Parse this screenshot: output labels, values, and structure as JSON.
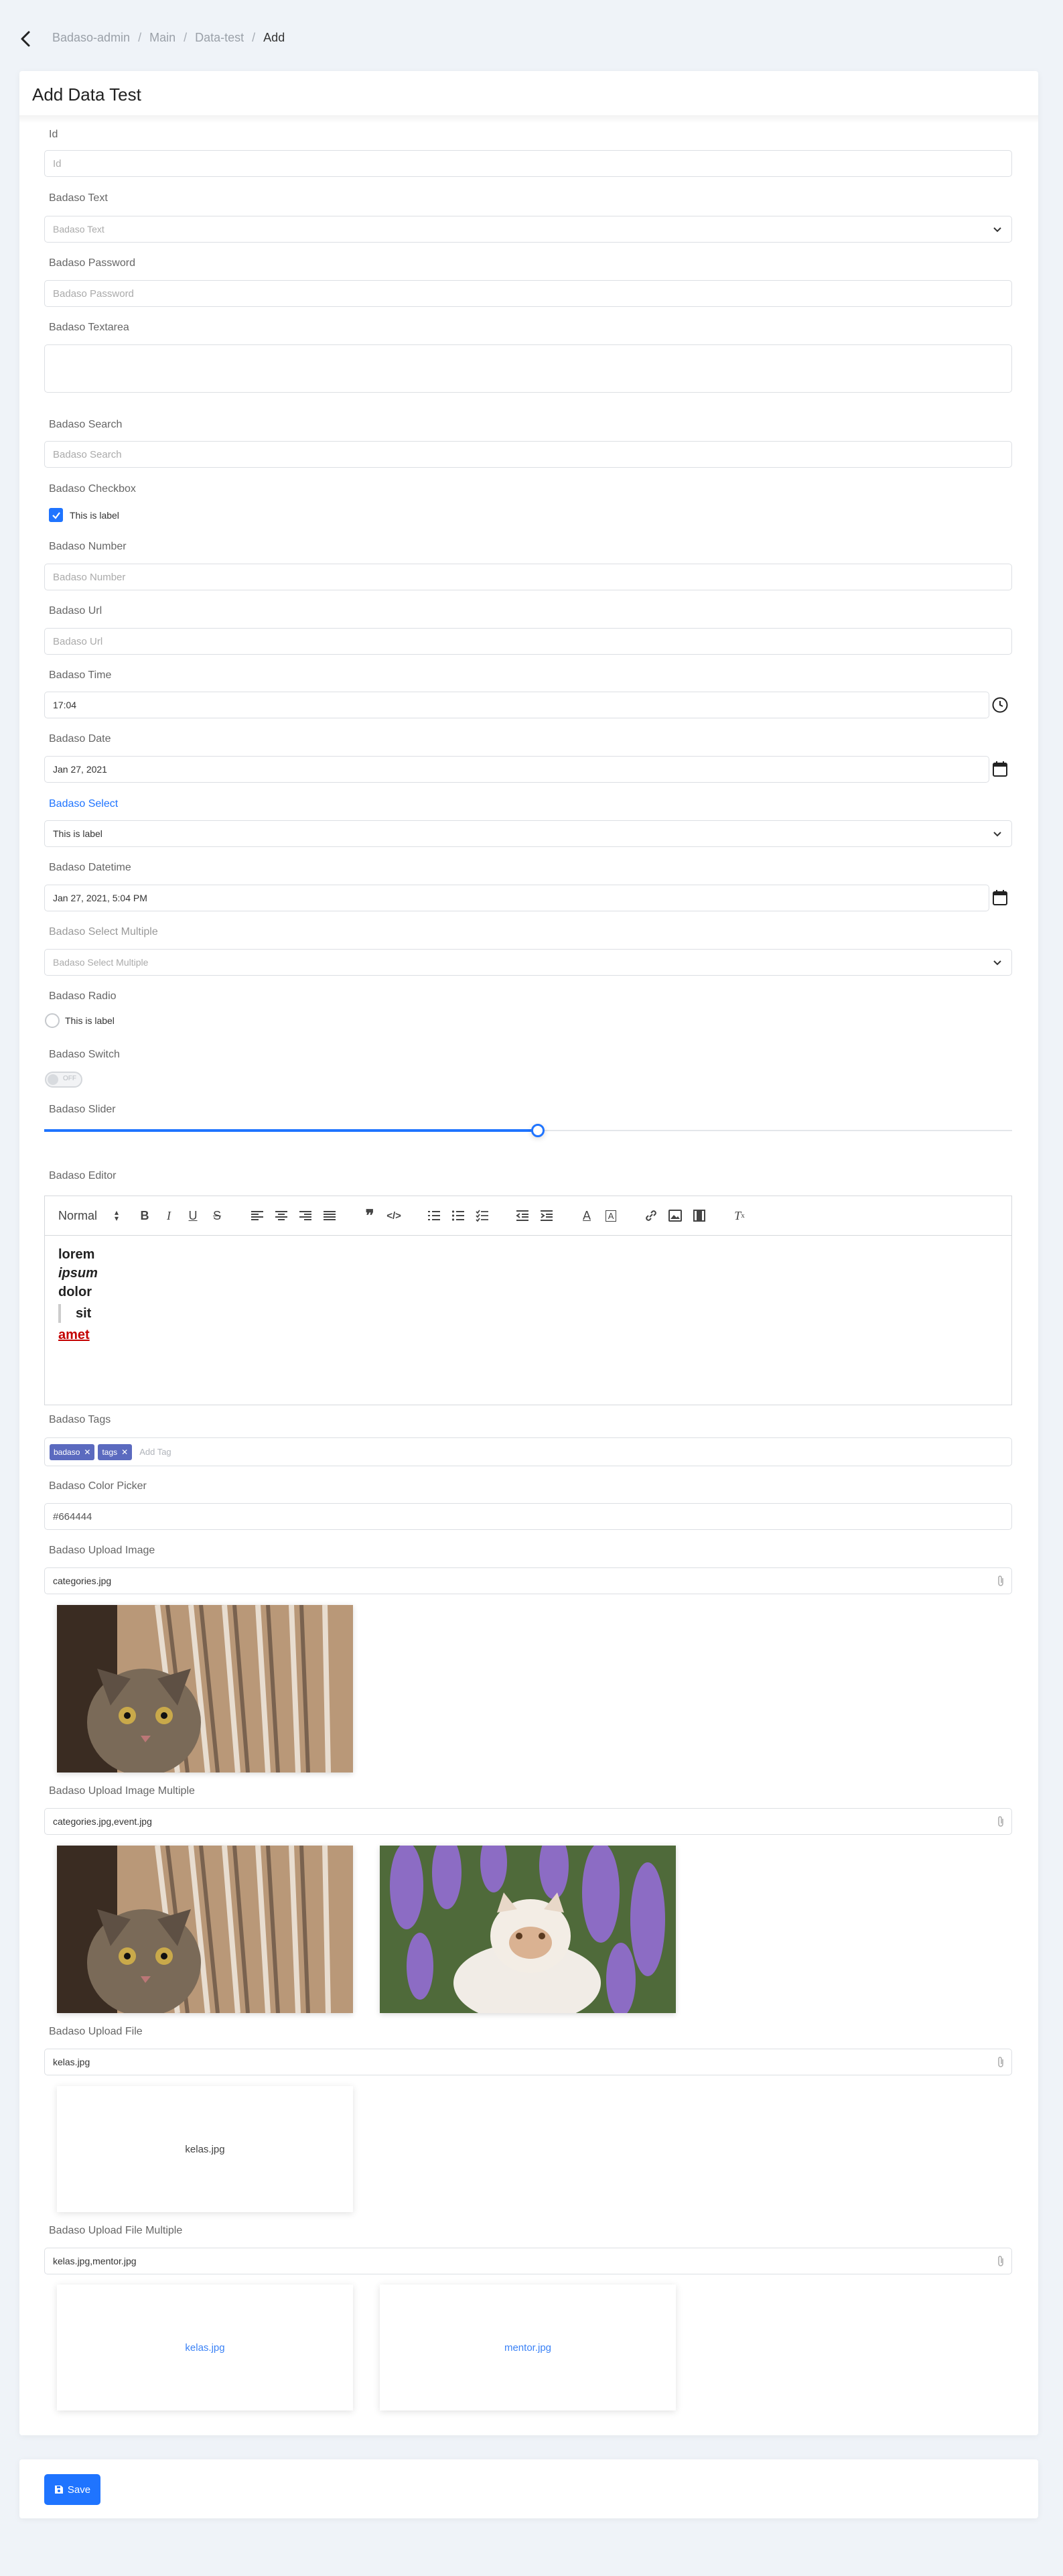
{
  "breadcrumb": {
    "items": [
      "Badaso-admin",
      "Main",
      "Data-test"
    ],
    "current": "Add"
  },
  "page_title": "Add Data Test",
  "fields": {
    "id": {
      "label": "Id",
      "placeholder": "Id"
    },
    "text": {
      "label": "Badaso Text",
      "placeholder": "Badaso Text"
    },
    "password": {
      "label": "Badaso Password",
      "placeholder": "Badaso Password"
    },
    "textarea": {
      "label": "Badaso Textarea"
    },
    "search": {
      "label": "Badaso Search",
      "placeholder": "Badaso Search"
    },
    "checkbox": {
      "label": "Badaso Checkbox",
      "option": "This is label",
      "checked": true
    },
    "number": {
      "label": "Badaso Number",
      "placeholder": "Badaso Number"
    },
    "url": {
      "label": "Badaso Url",
      "placeholder": "Badaso Url"
    },
    "time": {
      "label": "Badaso Time",
      "value": "17:04"
    },
    "date": {
      "label": "Badaso Date",
      "value": "Jan 27, 2021"
    },
    "select": {
      "label": "Badaso Select",
      "value": "This is label"
    },
    "datetime": {
      "label": "Badaso Datetime",
      "value": "Jan 27, 2021, 5:04 PM"
    },
    "select_multiple": {
      "label": "Badaso Select Multiple",
      "placeholder": "Badaso Select Multiple"
    },
    "radio": {
      "label": "Badaso Radio",
      "option": "This is label"
    },
    "switch": {
      "label": "Badaso Switch",
      "state_text": "OFF"
    },
    "slider": {
      "label": "Badaso Slider",
      "value": 0.51
    },
    "editor": {
      "label": "Badaso Editor",
      "format": "Normal",
      "lines": [
        "lorem",
        "ipsum",
        "dolor",
        "sit",
        "amet"
      ]
    },
    "tags": {
      "label": "Badaso Tags",
      "items": [
        "badaso",
        "tags"
      ],
      "placeholder": "Add Tag"
    },
    "color_picker": {
      "label": "Badaso Color Picker",
      "value": "#664444"
    },
    "upload_image": {
      "label": "Badaso Upload Image",
      "value": "categories.jpg"
    },
    "upload_image_multiple": {
      "label": "Badaso Upload Image Multiple",
      "value": "categories.jpg,event.jpg"
    },
    "upload_file": {
      "label": "Badaso Upload File",
      "value": "kelas.jpg",
      "preview": "kelas.jpg"
    },
    "upload_file_multiple": {
      "label": "Badaso Upload File Multiple",
      "value": "kelas.jpg,mentor.jpg",
      "previews": [
        "kelas.jpg",
        "mentor.jpg"
      ]
    }
  },
  "save_button": "Save",
  "colors": {
    "accent": "#1f74ff",
    "tag": "#5b6abf",
    "background": "#eff3f8"
  }
}
